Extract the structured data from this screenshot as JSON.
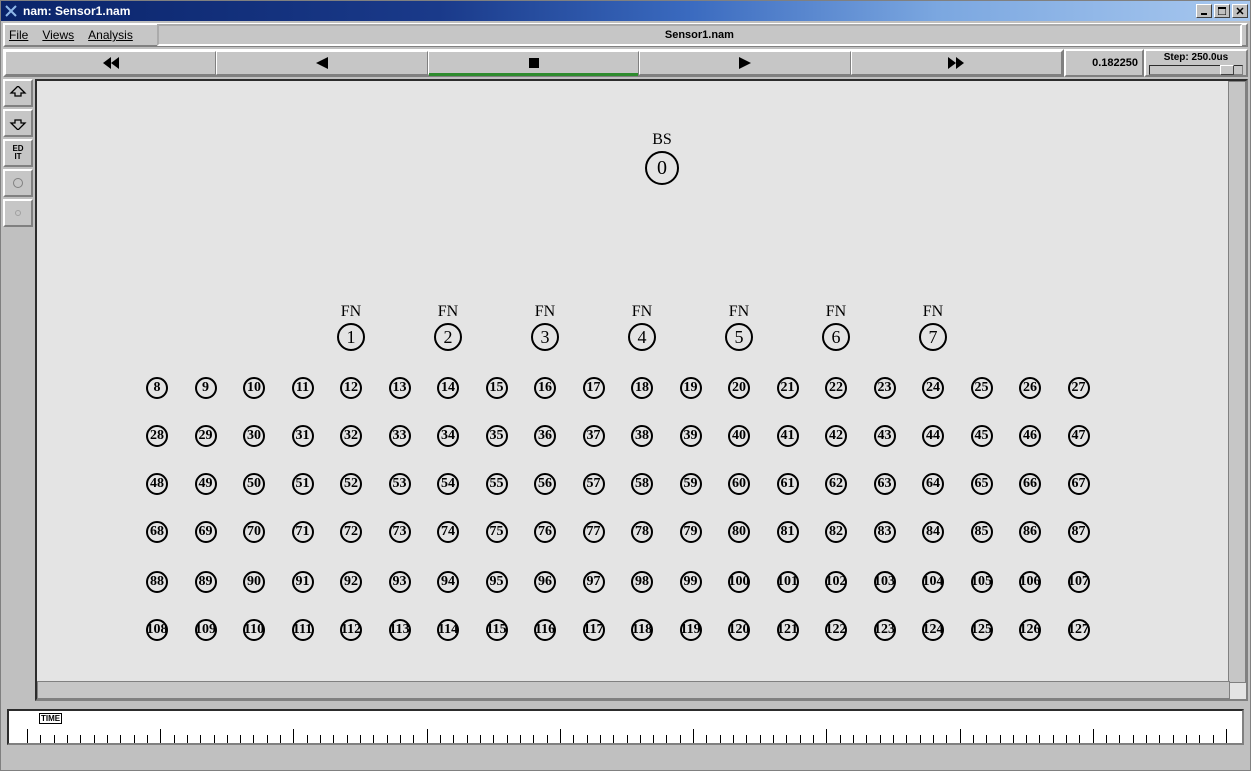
{
  "window": {
    "title": "nam: Sensor1.nam",
    "min_label": "_",
    "max_label": "□",
    "close_label": "×"
  },
  "menu": {
    "file": "File",
    "views": "Views",
    "analysis": "Analysis",
    "filename": "Sensor1.nam"
  },
  "playback": {
    "time": "0.182250",
    "step": "Step: 250.0us"
  },
  "left": {
    "edit": "ED\nIT"
  },
  "bs": {
    "label": "BS",
    "id": "0"
  },
  "fn_label": "FN",
  "fn": [
    "1",
    "2",
    "3",
    "4",
    "5",
    "6",
    "7"
  ],
  "grid": [
    [
      "8",
      "9",
      "10",
      "11",
      "12",
      "13",
      "14",
      "15",
      "16",
      "17",
      "18",
      "19",
      "20",
      "21",
      "22",
      "23",
      "24",
      "25",
      "26",
      "27"
    ],
    [
      "28",
      "29",
      "30",
      "31",
      "32",
      "33",
      "34",
      "35",
      "36",
      "37",
      "38",
      "39",
      "40",
      "41",
      "42",
      "43",
      "44",
      "45",
      "46",
      "47"
    ],
    [
      "48",
      "49",
      "50",
      "51",
      "52",
      "53",
      "54",
      "55",
      "56",
      "57",
      "58",
      "59",
      "60",
      "61",
      "62",
      "63",
      "64",
      "65",
      "66",
      "67"
    ],
    [
      "68",
      "69",
      "70",
      "71",
      "72",
      "73",
      "74",
      "75",
      "76",
      "77",
      "78",
      "79",
      "80",
      "81",
      "82",
      "83",
      "84",
      "85",
      "86",
      "87"
    ],
    [
      "88",
      "89",
      "90",
      "91",
      "92",
      "93",
      "94",
      "95",
      "96",
      "97",
      "98",
      "99",
      "100",
      "101",
      "102",
      "103",
      "104",
      "105",
      "106",
      "107"
    ],
    [
      "108",
      "109",
      "110",
      "111",
      "112",
      "113",
      "114",
      "115",
      "116",
      "117",
      "118",
      "119",
      "120",
      "121",
      "122",
      "123",
      "124",
      "125",
      "126",
      "127"
    ]
  ],
  "timeline": {
    "label": "TIME"
  }
}
